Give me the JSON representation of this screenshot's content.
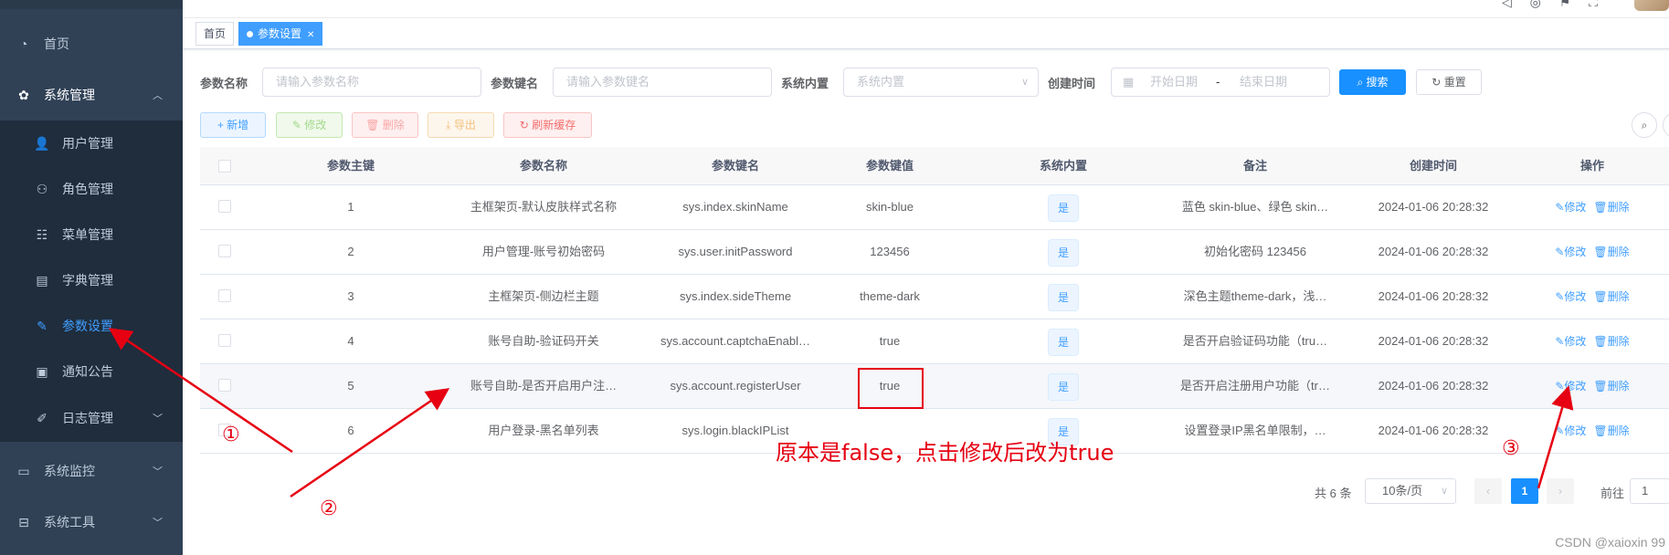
{
  "sidebar": {
    "items": [
      {
        "label": "首页",
        "icon": "dashboard-icon"
      },
      {
        "label": "系统管理",
        "icon": "gear-icon",
        "expanded": true
      },
      {
        "label": "系统监控",
        "icon": "monitor-icon"
      },
      {
        "label": "系统工具",
        "icon": "toolbox-icon"
      }
    ],
    "sub_items": [
      {
        "label": "用户管理",
        "icon": "user-icon"
      },
      {
        "label": "角色管理",
        "icon": "peoples-icon"
      },
      {
        "label": "菜单管理",
        "icon": "tree-table-icon"
      },
      {
        "label": "字典管理",
        "icon": "dict-icon"
      },
      {
        "label": "参数设置",
        "icon": "edit-icon",
        "active": true
      },
      {
        "label": "通知公告",
        "icon": "message-icon"
      },
      {
        "label": "日志管理",
        "icon": "log-icon"
      }
    ]
  },
  "tags": [
    {
      "label": "首页",
      "active": false
    },
    {
      "label": "参数设置",
      "active": true
    }
  ],
  "search": {
    "name_label": "参数名称",
    "name_placeholder": "请输入参数名称",
    "key_label": "参数键名",
    "key_placeholder": "请输入参数键名",
    "builtin_label": "系统内置",
    "builtin_placeholder": "系统内置",
    "time_label": "创建时间",
    "start_placeholder": "开始日期",
    "range_sep": "-",
    "end_placeholder": "结束日期",
    "search_btn": "搜索",
    "reset_btn": "重置"
  },
  "toolbar": {
    "add": "新增",
    "edit": "修改",
    "delete": "删除",
    "export": "导出",
    "refresh_cache": "刷新缓存"
  },
  "table": {
    "headers": [
      "参数主键",
      "参数名称",
      "参数键名",
      "参数键值",
      "系统内置",
      "备注",
      "创建时间",
      "操作"
    ],
    "rows": [
      {
        "id": "1",
        "name": "主框架页-默认皮肤样式名称",
        "key": "sys.index.skinName",
        "value": "skin-blue",
        "builtin": "是",
        "remark": "蓝色 skin-blue、绿色 skin…",
        "time": "2024-01-06 20:28:32"
      },
      {
        "id": "2",
        "name": "用户管理-账号初始密码",
        "key": "sys.user.initPassword",
        "value": "123456",
        "builtin": "是",
        "remark": "初始化密码 123456",
        "time": "2024-01-06 20:28:32"
      },
      {
        "id": "3",
        "name": "主框架页-侧边栏主题",
        "key": "sys.index.sideTheme",
        "value": "theme-dark",
        "builtin": "是",
        "remark": "深色主题theme-dark，浅…",
        "time": "2024-01-06 20:28:32"
      },
      {
        "id": "4",
        "name": "账号自助-验证码开关",
        "key": "sys.account.captchaEnabl…",
        "value": "true",
        "builtin": "是",
        "remark": "是否开启验证码功能（tru…",
        "time": "2024-01-06 20:28:32"
      },
      {
        "id": "5",
        "name": "账号自助-是否开启用户注…",
        "key": "sys.account.registerUser",
        "value": "true",
        "builtin": "是",
        "remark": "是否开启注册用户功能（tr…",
        "time": "2024-01-06 20:28:32"
      },
      {
        "id": "6",
        "name": "用户登录-黑名单列表",
        "key": "sys.login.blackIPList",
        "value": "",
        "builtin": "是",
        "remark": "设置登录IP黑名单限制，…",
        "time": "2024-01-06 20:28:32"
      }
    ],
    "op_edit": "修改",
    "op_delete": "删除"
  },
  "pagination": {
    "total": "共 6 条",
    "page_size": "10条/页",
    "current_page": "1",
    "goto_label": "前往",
    "goto_value": "1"
  },
  "annotations": {
    "note": "原本是false，点击修改后改为true",
    "marker1": "①",
    "marker2": "②",
    "marker3": "③",
    "color": "#e60012"
  },
  "watermark": "CSDN @xaioxin 99"
}
